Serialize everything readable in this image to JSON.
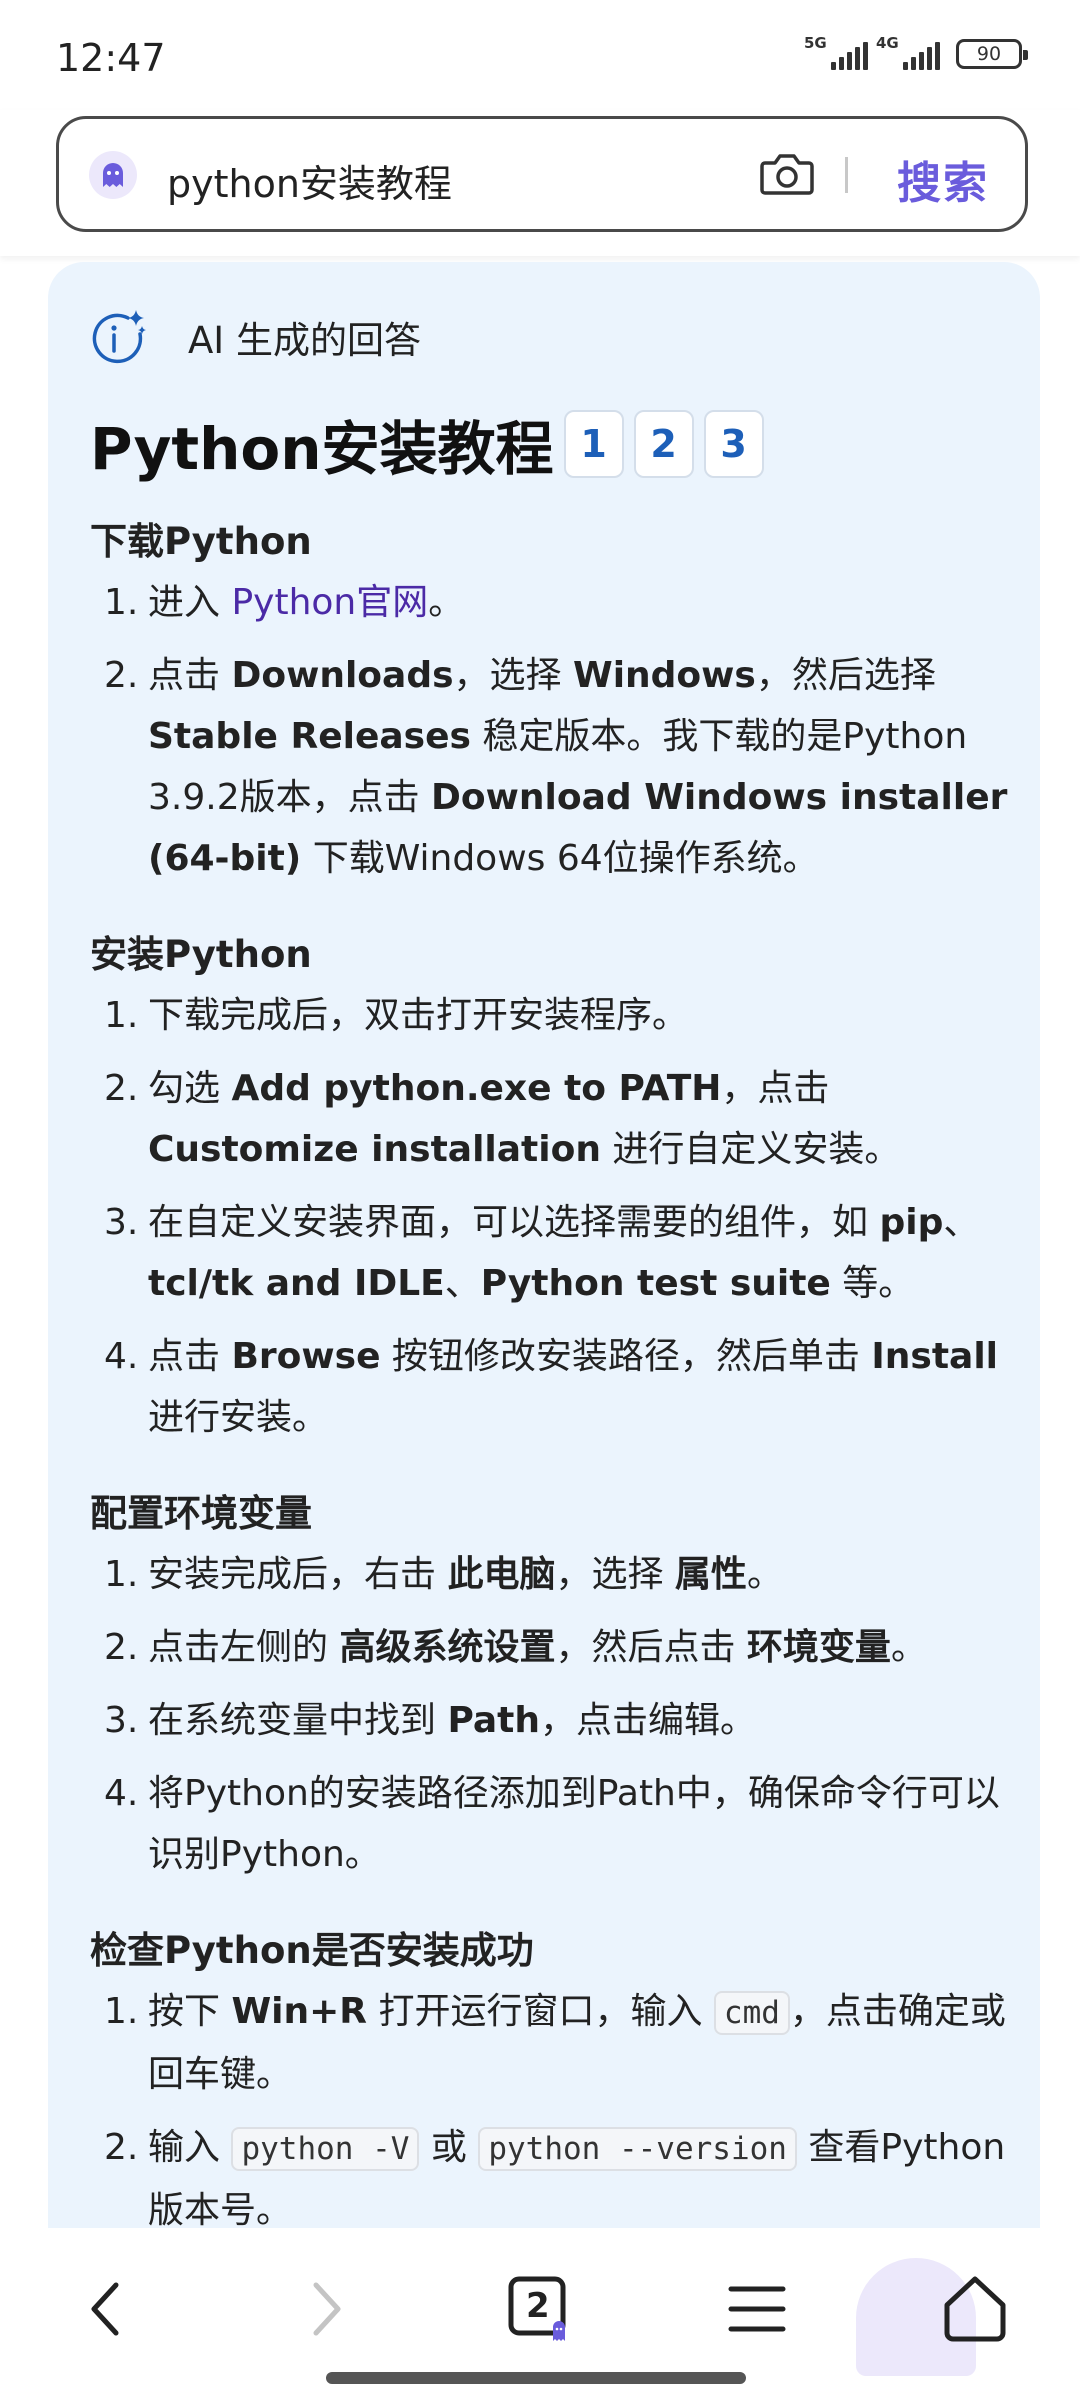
{
  "status_bar": {
    "time": "12:47",
    "signal1": "5G",
    "signal2": "4G",
    "battery": "90"
  },
  "search": {
    "query": "python安装教程",
    "button_label": "搜索"
  },
  "answer": {
    "ai_label": "AI 生成的回答",
    "title": "Python安装教程",
    "refs": [
      "1",
      "2",
      "3"
    ],
    "sections": [
      {
        "heading": "下载Python",
        "items": [
          [
            "进入 ",
            {
              "link": "Python官网"
            },
            "。"
          ],
          [
            "点击 ",
            {
              "b": "Downloads"
            },
            "，选择 ",
            {
              "b": "Windows"
            },
            "，然后选择 ",
            {
              "b": "Stable Releases"
            },
            " 稳定版本。我下载的是Python 3.9.2版本，点击 ",
            {
              "b": "Download Windows installer (64-bit)"
            },
            " 下载Windows 64位操作系统。"
          ]
        ]
      },
      {
        "heading": "安装Python",
        "items": [
          [
            "下载完成后，双击打开安装程序。"
          ],
          [
            "勾选 ",
            {
              "b": "Add python.exe to PATH"
            },
            "，点击 ",
            {
              "b": "Customize installation"
            },
            " 进行自定义安装。"
          ],
          [
            "在自定义安装界面，可以选择需要的组件，如 ",
            {
              "b": "pip"
            },
            "、",
            {
              "b": "tcl/tk and IDLE"
            },
            "、",
            {
              "b": "Python test suite"
            },
            " 等。"
          ],
          [
            "点击 ",
            {
              "b": "Browse"
            },
            " 按钮修改安装路径，然后单击 ",
            {
              "b": "Install"
            },
            " 进行安装。"
          ]
        ]
      },
      {
        "heading": "配置环境变量",
        "items": [
          [
            "安装完成后，右击 ",
            {
              "b": "此电脑"
            },
            "，选择 ",
            {
              "b": "属性"
            },
            "。"
          ],
          [
            "点击左侧的 ",
            {
              "b": "高级系统设置"
            },
            "，然后点击 ",
            {
              "b": "环境变量"
            },
            "。"
          ],
          [
            "在系统变量中找到 ",
            {
              "b": "Path"
            },
            "，点击编辑。"
          ],
          [
            "将Python的安装路径添加到Path中，确保命令行可以识别Python。"
          ]
        ]
      },
      {
        "heading": "检查Python是否安装成功",
        "items": [
          [
            "按下 ",
            {
              "b": "Win+R"
            },
            " 打开运行窗口，输入 ",
            {
              "code": "cmd"
            },
            "，点击确定或回车键。"
          ],
          [
            "输入 ",
            {
              "code": "python -V"
            },
            " 或 ",
            {
              "code": "python --version"
            },
            " 查看Python版本号。"
          ]
        ]
      }
    ]
  },
  "nav": {
    "tab_count": "2"
  },
  "colors": {
    "accent": "#6a5cdc",
    "card_bg": "#ebf4fd",
    "ref_text": "#1d5fb8",
    "link": "#4b2aa6"
  }
}
